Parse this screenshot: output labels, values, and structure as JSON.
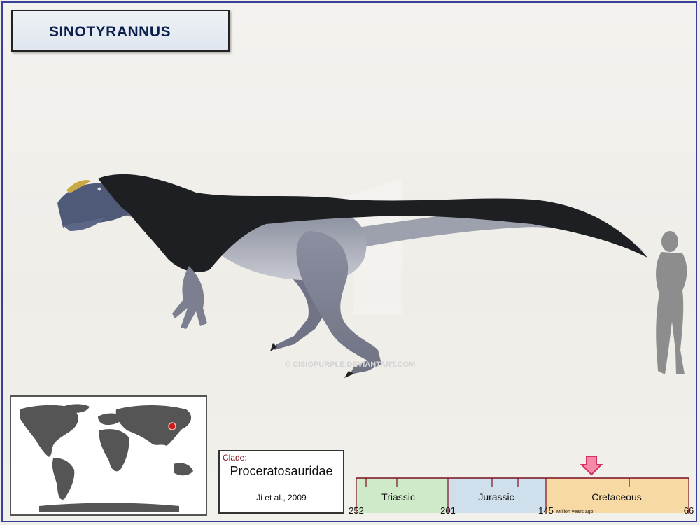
{
  "title": "SINOTYRANNUS",
  "watermark": "© CISIOPURPLE.DEVIANTART.COM",
  "clade": {
    "label": "Clade:",
    "name": "Proceratosauridae",
    "author": "Ji et al., 2009"
  },
  "timeline": {
    "periods": [
      "Triassic",
      "Jurassic",
      "Cretaceous"
    ],
    "ticks": [
      "252",
      "201",
      "145",
      "66"
    ],
    "unit": "Million years ago",
    "period_colors": {
      "Triassic": "#cfeac8",
      "Jurassic": "#cfe0ec",
      "Cretaceous": "#f7d9a4"
    },
    "marker_color": "#e8507a"
  },
  "map": {
    "marker_color": "#d01818",
    "land_color": "#555555"
  },
  "colors": {
    "frame": "#3a3f9a",
    "title_text": "#0b1f4f",
    "clade_label": "#7a1020"
  },
  "icons": {
    "location_marker": "red-dot-icon",
    "time_marker": "down-arrow-icon",
    "scale_figure": "human-silhouette-icon"
  }
}
